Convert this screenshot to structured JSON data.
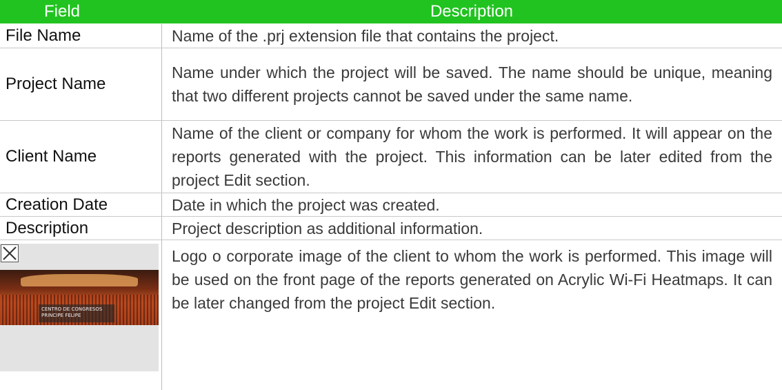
{
  "header": {
    "field": "Field",
    "description": "Description"
  },
  "rows": [
    {
      "field": "File Name",
      "description": "Name of the .prj extension file that contains the project."
    },
    {
      "field": "Project Name",
      "description": "Name under which the project will be saved. The name should be unique, meaning that two different projects cannot be saved under the same name."
    },
    {
      "field": "Client Name",
      "description": "Name of the client or company for whom the work is performed. It will appear on the reports generated with the project. This information can be later edited from the project Edit section."
    },
    {
      "field": "Creation Date",
      "description": "Date in which the project was created."
    },
    {
      "field": "Description",
      "description": "Project description as additional information."
    },
    {
      "field_image": {
        "icon": "broken-image-icon",
        "caption_line1": "CENTRO DE CONGRESOS",
        "caption_line2": "PRINCIPE FELIPE"
      },
      "description": "Logo o corporate image of the client to whom the work is performed. This image will be used on the front page of the reports generated on Acrylic Wi-Fi Heatmaps. It can be later changed from the project Edit section."
    }
  ],
  "colors": {
    "header_bg": "#21c320",
    "header_text": "#ffffff",
    "border": "#c8c8c8"
  }
}
